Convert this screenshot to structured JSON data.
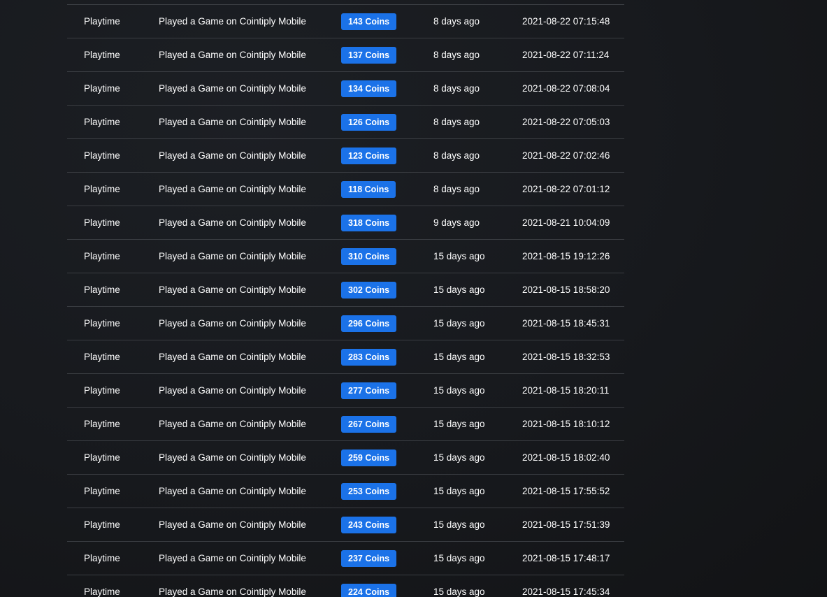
{
  "transactions": [
    {
      "type": "Playtime",
      "description": "Played a Game on Cointiply Mobile",
      "amount": "143 Coins",
      "ago": "8 days ago",
      "date": "2021-08-22 07:15:48"
    },
    {
      "type": "Playtime",
      "description": "Played a Game on Cointiply Mobile",
      "amount": "137 Coins",
      "ago": "8 days ago",
      "date": "2021-08-22 07:11:24"
    },
    {
      "type": "Playtime",
      "description": "Played a Game on Cointiply Mobile",
      "amount": "134 Coins",
      "ago": "8 days ago",
      "date": "2021-08-22 07:08:04"
    },
    {
      "type": "Playtime",
      "description": "Played a Game on Cointiply Mobile",
      "amount": "126 Coins",
      "ago": "8 days ago",
      "date": "2021-08-22 07:05:03"
    },
    {
      "type": "Playtime",
      "description": "Played a Game on Cointiply Mobile",
      "amount": "123 Coins",
      "ago": "8 days ago",
      "date": "2021-08-22 07:02:46"
    },
    {
      "type": "Playtime",
      "description": "Played a Game on Cointiply Mobile",
      "amount": "118 Coins",
      "ago": "8 days ago",
      "date": "2021-08-22 07:01:12"
    },
    {
      "type": "Playtime",
      "description": "Played a Game on Cointiply Mobile",
      "amount": "318 Coins",
      "ago": "9 days ago",
      "date": "2021-08-21 10:04:09"
    },
    {
      "type": "Playtime",
      "description": "Played a Game on Cointiply Mobile",
      "amount": "310 Coins",
      "ago": "15 days ago",
      "date": "2021-08-15 19:12:26"
    },
    {
      "type": "Playtime",
      "description": "Played a Game on Cointiply Mobile",
      "amount": "302 Coins",
      "ago": "15 days ago",
      "date": "2021-08-15 18:58:20"
    },
    {
      "type": "Playtime",
      "description": "Played a Game on Cointiply Mobile",
      "amount": "296 Coins",
      "ago": "15 days ago",
      "date": "2021-08-15 18:45:31"
    },
    {
      "type": "Playtime",
      "description": "Played a Game on Cointiply Mobile",
      "amount": "283 Coins",
      "ago": "15 days ago",
      "date": "2021-08-15 18:32:53"
    },
    {
      "type": "Playtime",
      "description": "Played a Game on Cointiply Mobile",
      "amount": "277 Coins",
      "ago": "15 days ago",
      "date": "2021-08-15 18:20:11"
    },
    {
      "type": "Playtime",
      "description": "Played a Game on Cointiply Mobile",
      "amount": "267 Coins",
      "ago": "15 days ago",
      "date": "2021-08-15 18:10:12"
    },
    {
      "type": "Playtime",
      "description": "Played a Game on Cointiply Mobile",
      "amount": "259 Coins",
      "ago": "15 days ago",
      "date": "2021-08-15 18:02:40"
    },
    {
      "type": "Playtime",
      "description": "Played a Game on Cointiply Mobile",
      "amount": "253 Coins",
      "ago": "15 days ago",
      "date": "2021-08-15 17:55:52"
    },
    {
      "type": "Playtime",
      "description": "Played a Game on Cointiply Mobile",
      "amount": "243 Coins",
      "ago": "15 days ago",
      "date": "2021-08-15 17:51:39"
    },
    {
      "type": "Playtime",
      "description": "Played a Game on Cointiply Mobile",
      "amount": "237 Coins",
      "ago": "15 days ago",
      "date": "2021-08-15 17:48:17"
    },
    {
      "type": "Playtime",
      "description": "Played a Game on Cointiply Mobile",
      "amount": "224 Coins",
      "ago": "15 days ago",
      "date": "2021-08-15 17:45:34"
    }
  ],
  "colors": {
    "background": "#17191d",
    "row_divider": "#3a3d42",
    "badge": "#1b72e8",
    "text": "#ffffff"
  }
}
